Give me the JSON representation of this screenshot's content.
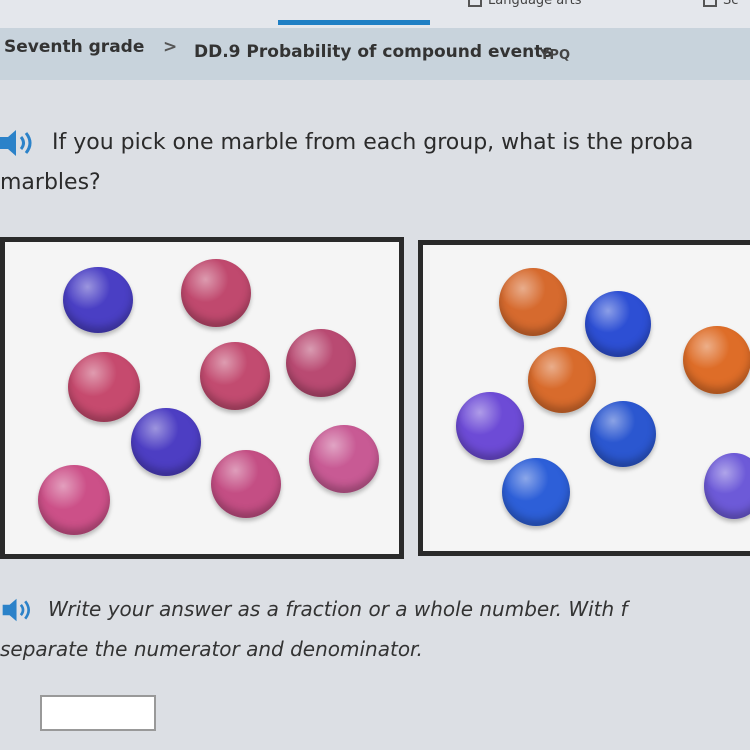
{
  "nav": {
    "tabs": [
      {
        "label": "Language arts",
        "icon": "book-icon"
      },
      {
        "label": "Sc",
        "icon": "flask-icon"
      }
    ]
  },
  "breadcrumb": {
    "grade": "Seventh grade",
    "separator": ">",
    "skill": "DD.9 Probability of compound events",
    "code": "YPQ"
  },
  "question": {
    "line1": "If you pick one marble from each group, what is the proba",
    "line2": "marbles?"
  },
  "group1": {
    "marbles": [
      {
        "color": "#4a3fc4"
      },
      {
        "color": "#c0496e"
      },
      {
        "color": "#c64a6e"
      },
      {
        "color": "#c24b70"
      },
      {
        "color": "#b94a72"
      },
      {
        "color": "#4d3ec3"
      },
      {
        "color": "#cc5088"
      },
      {
        "color": "#c44e84"
      },
      {
        "color": "#c85a94"
      }
    ]
  },
  "group2": {
    "marbles": [
      {
        "color": "#d66a2e"
      },
      {
        "color": "#2d4fd4"
      },
      {
        "color": "#d86b2c"
      },
      {
        "color": "#de6d28"
      },
      {
        "color": "#6d4bd6"
      },
      {
        "color": "#2b57d0"
      },
      {
        "color": "#2d5fd8"
      },
      {
        "color": "#6d5ad8"
      }
    ]
  },
  "instructions": {
    "line1": "Write your answer as a fraction or a whole number. With f",
    "line2": "separate the numerator and denominator."
  },
  "answer": {
    "value": ""
  },
  "colors": {
    "accent": "#2b82c9",
    "crumb_bg": "#c8d3dc"
  }
}
